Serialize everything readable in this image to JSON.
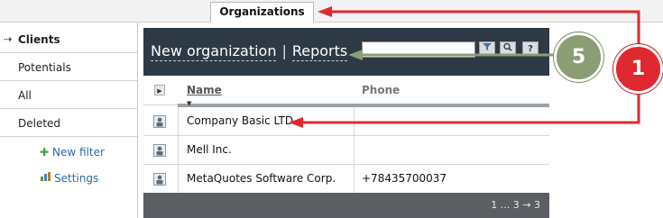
{
  "top_tab": {
    "label": "Organizations"
  },
  "sidebar": {
    "items": [
      {
        "label": "Clients",
        "active": true,
        "arrow": "⇢"
      },
      {
        "label": "Potentials",
        "active": false
      },
      {
        "label": "All",
        "active": false
      },
      {
        "label": "Deleted",
        "active": false
      }
    ],
    "links": [
      {
        "label": "New filter",
        "icon": "plus-icon"
      },
      {
        "label": "Settings",
        "icon": "settings-icon"
      }
    ]
  },
  "header": {
    "new_org_label": "New organization",
    "separator": "|",
    "reports_label": "Reports",
    "buttons": {
      "filter": "▼",
      "search": "🔍",
      "help": "?"
    }
  },
  "table": {
    "columns": {
      "name": "Name",
      "phone": "Phone"
    },
    "rows": [
      {
        "name": "Company Basic LTD",
        "phone": ""
      },
      {
        "name": "Mell Inc.",
        "phone": ""
      },
      {
        "name": "MetaQuotes Software Corp.",
        "phone": "+78435700037"
      }
    ]
  },
  "pager": {
    "text": "1 ... 3 → 3"
  },
  "annotations": {
    "callout_5": "5",
    "callout_1": "1",
    "colors": {
      "red": "#e02830",
      "green": "#8b9d74"
    }
  }
}
